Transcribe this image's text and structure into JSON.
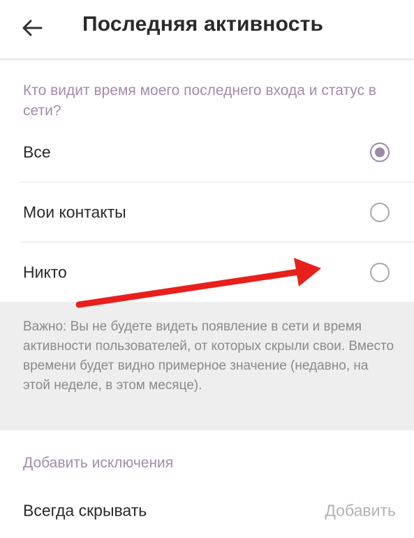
{
  "header": {
    "title": "Последняя активность",
    "back_icon": "arrow-left-icon"
  },
  "visibility": {
    "question": "Кто видит время моего последнего входа и статус в сети?",
    "options": [
      {
        "label": "Все",
        "selected": true
      },
      {
        "label": "Мои контакты",
        "selected": false
      },
      {
        "label": "Никто",
        "selected": false
      }
    ]
  },
  "note": {
    "text": "Важно: Вы не будете видеть появление в сети и время активности пользователей, от которых скрыли свои. Вместо времени будет видно примерное значение (недавно, на этой неделе, в этом месяце)."
  },
  "exceptions": {
    "title": "Добавить исключения",
    "always_hide_label": "Всегда скрывать",
    "add_label": "Добавить"
  },
  "colors": {
    "accent": "#9c8aa8",
    "section_header": "#a48aac",
    "annotation_arrow": "#e8201c"
  }
}
